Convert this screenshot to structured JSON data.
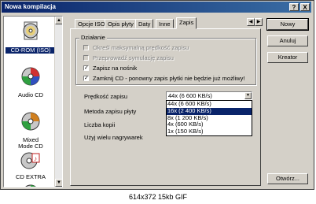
{
  "window": {
    "title": "Nowa kompilacja",
    "help_btn": "?",
    "close_btn": "X"
  },
  "categories": [
    {
      "label": "CD-ROM (ISO)",
      "selected": true
    },
    {
      "label": "Audio CD",
      "selected": false
    },
    {
      "label": "Mixed Mode CD",
      "selected": false
    },
    {
      "label": "CD EXTRA",
      "selected": false
    }
  ],
  "tabs": [
    "Opcje ISO",
    "Opis płyty",
    "Daty",
    "Inne",
    "Zapis"
  ],
  "active_tab": "Zapis",
  "tab_arrows": {
    "left": "◀",
    "right": "▶"
  },
  "action": {
    "group_title": "Działanie",
    "options": [
      {
        "label": "Określ maksymalną prędkość zapisu",
        "checked": false,
        "enabled": false
      },
      {
        "label": "Przeprowadź symulację zapisu",
        "checked": false,
        "enabled": false
      },
      {
        "label": "Zapisz na nośnik",
        "checked": true,
        "enabled": true
      },
      {
        "label": "Zamknij CD - ponowny zapis płytki nie będzie już możliwy!",
        "checked": true,
        "enabled": true
      }
    ]
  },
  "fields": {
    "speed_label": "Prędkość zapisu",
    "method_label": "Metoda zapisu płyty",
    "copies_label": "Liczba kopii",
    "multi_label": "Użyj wielu nagrywarek"
  },
  "speed_combo": {
    "value": "44x (6 600 KB/s)",
    "options": [
      {
        "label": "44x (6 600 KB/s)",
        "selected": false
      },
      {
        "label": "16x (2 400 KB/s)",
        "selected": true
      },
      {
        "label": "8x (1 200 KB/s)",
        "selected": false
      },
      {
        "label": "4x (600 KB/s)",
        "selected": false
      },
      {
        "label": "1x (150 KB/s)",
        "selected": false
      }
    ]
  },
  "buttons": {
    "new": "Nowy",
    "cancel": "Anuluj",
    "wizard": "Kreator",
    "open": "Otwórz..."
  },
  "caption": "614x372 15kb GIF",
  "colors": {
    "titlebar": "#0a246a",
    "selection": "#0a246a",
    "face": "#d4d0c8"
  }
}
